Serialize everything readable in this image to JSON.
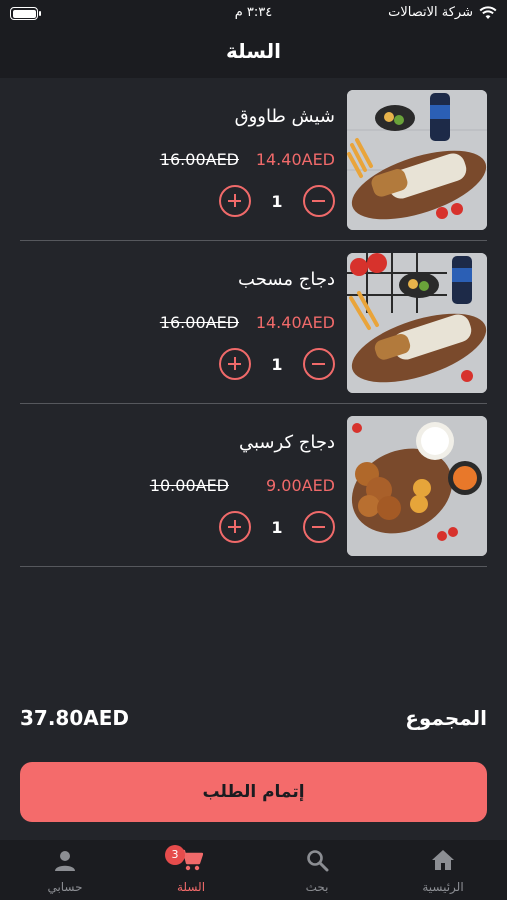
{
  "status_bar": {
    "carrier": "شركة الاتصالات",
    "time": "٣:٣٤ م"
  },
  "header": {
    "title": "السلة"
  },
  "cart": {
    "items": [
      {
        "name": "شيش طاووق",
        "price": "14.40AED",
        "old_price": "16.00AED",
        "quantity": "1"
      },
      {
        "name": "دجاج مسحب",
        "price": "14.40AED",
        "old_price": "16.00AED",
        "quantity": "1"
      },
      {
        "name": "دجاج كرسبي",
        "price": "9.00AED",
        "old_price": "10.00AED",
        "quantity": "1"
      }
    ]
  },
  "summary": {
    "total_label": "المجموع",
    "total_value": "37.80AED"
  },
  "checkout": {
    "label": "إتمام الطلب"
  },
  "tab_bar": {
    "tabs": [
      {
        "label": "حسابي",
        "icon": "person-icon"
      },
      {
        "label": "السلة",
        "icon": "cart-icon",
        "badge": "3",
        "active": true
      },
      {
        "label": "بحث",
        "icon": "search-icon"
      },
      {
        "label": "الرئيسية",
        "icon": "home-icon"
      }
    ]
  },
  "colors": {
    "accent": "#f06a6a",
    "button": "#f46b6b",
    "background": "#23252a",
    "bar": "#1b1c20",
    "inactive": "#8c8e93"
  }
}
